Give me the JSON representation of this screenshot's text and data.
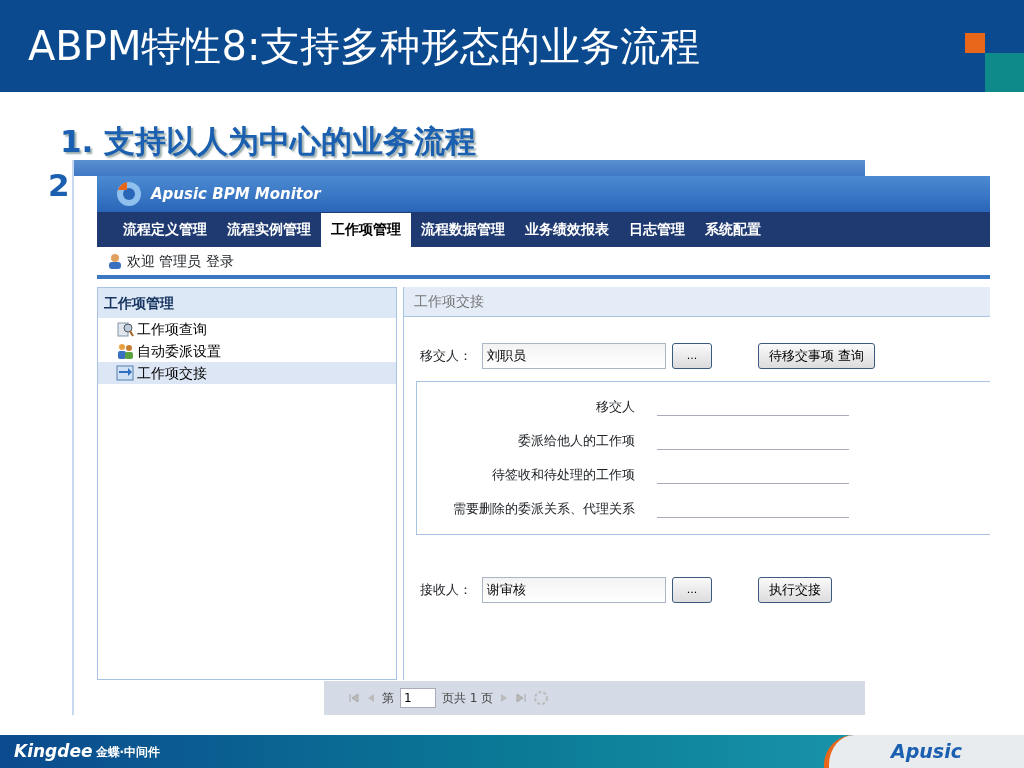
{
  "slide": {
    "title": "ABPM特性8:支持多种形态的业务流程",
    "points": [
      "1. 支持以人为中心的业务流程",
      "2"
    ]
  },
  "back_window": {
    "pager": {
      "page_prefix": "第",
      "page": "1",
      "page_suffix": "页共 1 页"
    }
  },
  "window": {
    "title": "Apusic BPM Monitor",
    "tabs": [
      {
        "label": "流程定义管理",
        "selected": false
      },
      {
        "label": "流程实例管理",
        "selected": false
      },
      {
        "label": "工作项管理",
        "selected": true
      },
      {
        "label": "流程数据管理",
        "selected": false
      },
      {
        "label": "业务绩效报表",
        "selected": false
      },
      {
        "label": "日志管理",
        "selected": false
      },
      {
        "label": "系统配置",
        "selected": false
      }
    ],
    "welcome": "欢迎 管理员 登录",
    "sidebar": {
      "title": "工作项管理",
      "items": [
        {
          "label": "工作项查询",
          "kind": "search",
          "selected": false
        },
        {
          "label": "自动委派设置",
          "kind": "people",
          "selected": false
        },
        {
          "label": "工作项交接",
          "kind": "swap",
          "selected": true
        }
      ]
    },
    "panel": {
      "title": "工作项交接",
      "from": {
        "label": "移交人：",
        "value": "刘职员",
        "browse": "...",
        "action": "待移交事项 查询"
      },
      "summary": [
        "移交人",
        "委派给他人的工作项",
        "待签收和待处理的工作项",
        "需要删除的委派关系、代理关系"
      ],
      "to": {
        "label": "接收人：",
        "value": "谢审核",
        "browse": "...",
        "action": "执行交接"
      }
    }
  },
  "footer": {
    "left_logo": "Kingdee",
    "left_text": "金蝶·中间件",
    "right_logo": "Apusic"
  }
}
